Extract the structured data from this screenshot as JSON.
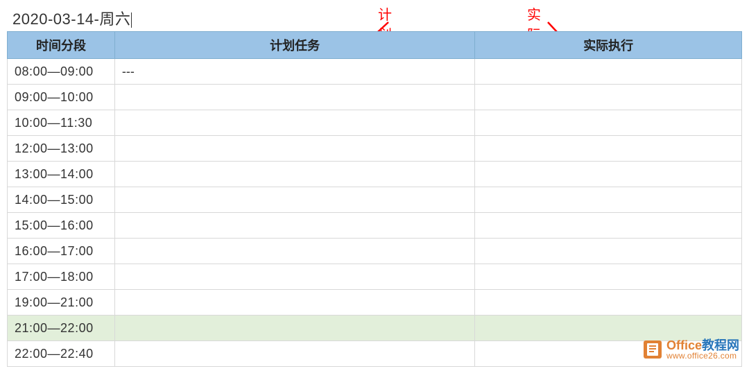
{
  "title": "2020-03-14-周六",
  "annotations": {
    "plan_label": "计划区",
    "actual_label": "实际记录区"
  },
  "headers": {
    "time": "时间分段",
    "plan": "计划任务",
    "actual": "实际执行"
  },
  "rows": [
    {
      "time": "08:00—09:00",
      "plan": "---",
      "actual": "",
      "highlight": false
    },
    {
      "time": "09:00—10:00",
      "plan": "",
      "actual": "",
      "highlight": false
    },
    {
      "time": "10:00—11:30",
      "plan": "",
      "actual": "",
      "highlight": false
    },
    {
      "time": "12:00—13:00",
      "plan": "",
      "actual": "",
      "highlight": false
    },
    {
      "time": "13:00—14:00",
      "plan": "",
      "actual": "",
      "highlight": false
    },
    {
      "time": "14:00—15:00",
      "plan": "",
      "actual": "",
      "highlight": false
    },
    {
      "time": "15:00—16:00",
      "plan": "",
      "actual": "",
      "highlight": false
    },
    {
      "time": "16:00—17:00",
      "plan": "",
      "actual": "",
      "highlight": false
    },
    {
      "time": "17:00—18:00",
      "plan": "",
      "actual": "",
      "highlight": false
    },
    {
      "time": "19:00—21:00",
      "plan": "",
      "actual": "",
      "highlight": false
    },
    {
      "time": "21:00—22:00",
      "plan": "",
      "actual": "",
      "highlight": true
    },
    {
      "time": "22:00—22:40",
      "plan": "",
      "actual": "",
      "highlight": false
    }
  ],
  "watermark": {
    "title_part1": "Office",
    "title_part2": "教程网",
    "url": "www.office26.com"
  },
  "colors": {
    "header_bg": "#9bc3e6",
    "highlight_bg": "#e2efda",
    "annotation": "#ff0000",
    "wm_orange": "#e07b2a",
    "wm_blue": "#1e6fb8"
  }
}
